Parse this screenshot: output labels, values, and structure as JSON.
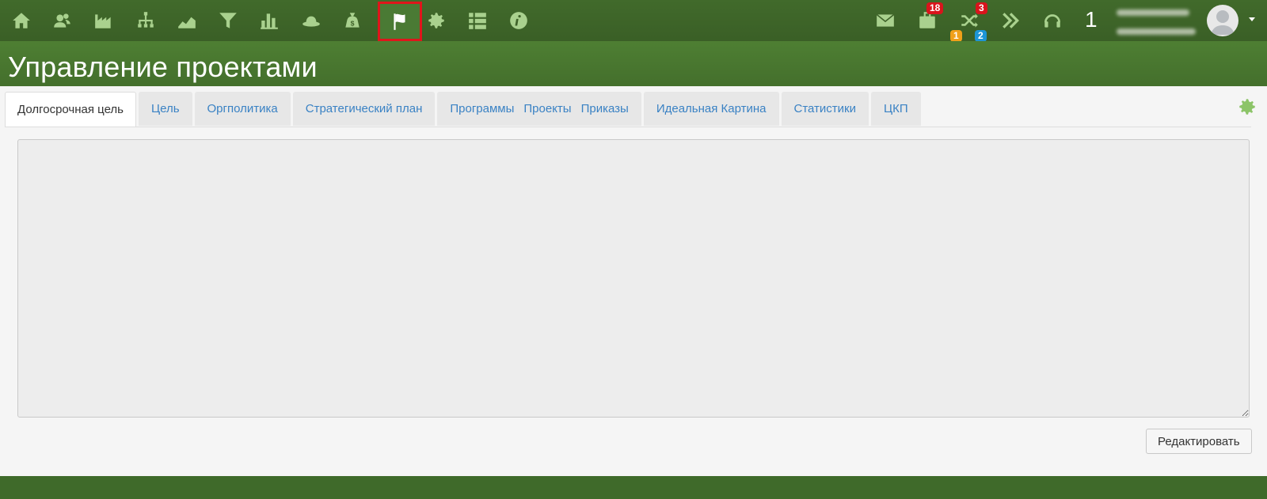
{
  "nav": {
    "icons": [
      "home-icon",
      "users-icon",
      "factory-icon",
      "org-chart-icon",
      "area-chart-icon",
      "funnel-icon",
      "bar-chart-icon",
      "hat-icon",
      "money-bag-icon",
      "flag-icon",
      "gear-icon",
      "list-icon",
      "info-icon"
    ],
    "right": {
      "mail_icon": "mail-icon",
      "briefcase_badge": "18",
      "shuffle_badge_top": "3",
      "shuffle_badge_left": "1",
      "shuffle_badge_right": "2",
      "counter": "1"
    }
  },
  "page": {
    "title": "Управление проектами"
  },
  "tabs": [
    {
      "label": "Долгосрочная цель",
      "active": true
    },
    {
      "label": "Цель"
    },
    {
      "label": "Оргполитика"
    },
    {
      "label": "Стратегический план"
    },
    {
      "labels": [
        "Программы",
        "Проекты",
        "Приказы"
      ]
    },
    {
      "label": "Идеальная Картина"
    },
    {
      "label": "Статистики"
    },
    {
      "label": "ЦКП"
    }
  ],
  "editor": {
    "value": "",
    "edit_button": "Редактировать"
  },
  "colors": {
    "topbar": "#3e6229",
    "header": "#4a7a30",
    "icon_green": "#a9d18e",
    "tab_link": "#3a82c4",
    "badge_red": "#d9141c",
    "badge_orange": "#f0a019",
    "badge_blue": "#1d95d6"
  }
}
